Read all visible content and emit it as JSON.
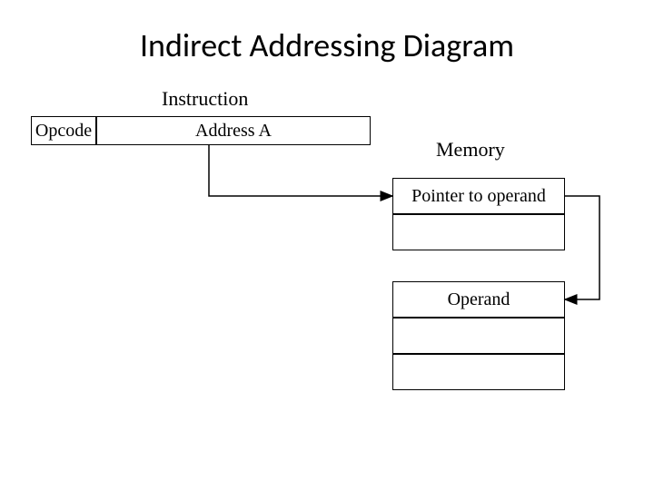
{
  "title": "Indirect Addressing Diagram",
  "instruction_label": "Instruction",
  "opcode": "Opcode",
  "address_a": "Address A",
  "memory_label": "Memory",
  "pointer_text": "Pointer to operand",
  "operand_text": "Operand"
}
